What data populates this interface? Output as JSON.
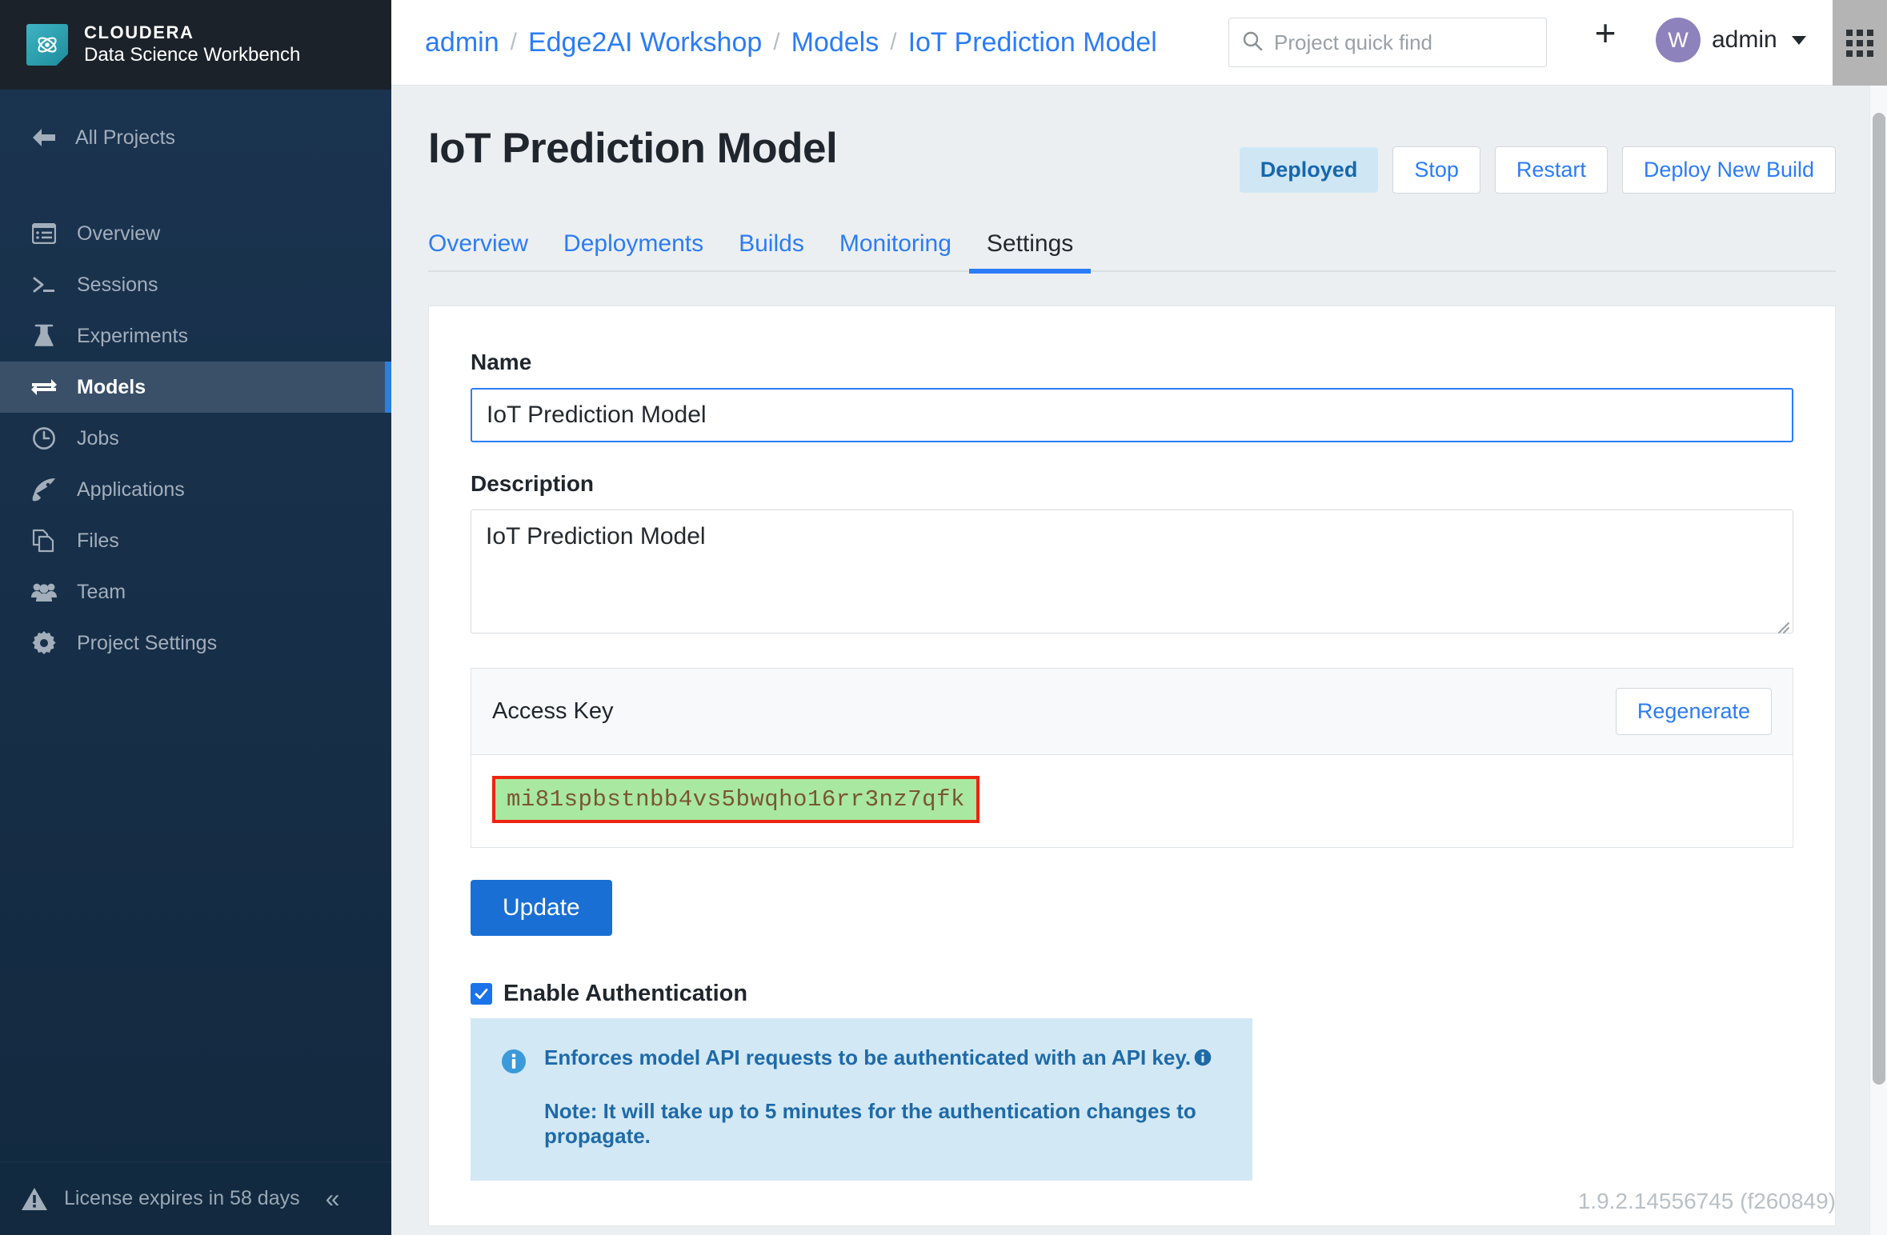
{
  "brand": {
    "logo_icon": "cloudera-atom-icon",
    "name_top": "CLOUDERA",
    "name_sub": "Data Science Workbench"
  },
  "sidebar": {
    "back_label": "All Projects",
    "back_icon": "arrow-left-icon",
    "items": [
      {
        "label": "Overview",
        "icon": "list-panel-icon",
        "active": false
      },
      {
        "label": "Sessions",
        "icon": "terminal-prompt-icon",
        "active": false
      },
      {
        "label": "Experiments",
        "icon": "flask-icon",
        "active": false
      },
      {
        "label": "Models",
        "icon": "exchange-arrows-icon",
        "active": true
      },
      {
        "label": "Jobs",
        "icon": "clock-icon",
        "active": false
      },
      {
        "label": "Applications",
        "icon": "rocket-icon",
        "active": false
      },
      {
        "label": "Files",
        "icon": "files-copy-icon",
        "active": false
      },
      {
        "label": "Team",
        "icon": "people-group-icon",
        "active": false
      },
      {
        "label": "Project Settings",
        "icon": "gear-icon",
        "active": false
      }
    ],
    "license_text": "License expires in 58 days",
    "license_icon": "warning-triangle-icon",
    "collapse_icon": "double-chevron-left-icon"
  },
  "topbar": {
    "breadcrumb": [
      {
        "label": "admin"
      },
      {
        "label": "Edge2AI Workshop"
      },
      {
        "label": "Models"
      },
      {
        "label": "IoT Prediction Model"
      }
    ],
    "separator": "/",
    "search": {
      "placeholder": "Project quick find",
      "value": "",
      "icon": "search-icon"
    },
    "add_icon": "plus-icon",
    "user": {
      "avatar_letter": "W",
      "name": "admin",
      "caret_icon": "chevron-down-icon"
    },
    "apps_grid_icon": "grid-apps-icon"
  },
  "page": {
    "title": "IoT Prediction Model",
    "status_badge": "Deployed",
    "actions": [
      {
        "label": "Stop"
      },
      {
        "label": "Restart"
      },
      {
        "label": "Deploy New Build"
      }
    ],
    "tabs": [
      {
        "label": "Overview",
        "active": false
      },
      {
        "label": "Deployments",
        "active": false
      },
      {
        "label": "Builds",
        "active": false
      },
      {
        "label": "Monitoring",
        "active": false
      },
      {
        "label": "Settings",
        "active": true
      }
    ]
  },
  "form": {
    "name_label": "Name",
    "name_value": "IoT Prediction Model",
    "name_placeholder": "",
    "description_label": "Description",
    "description_value": "IoT Prediction Model",
    "description_placeholder": "",
    "access_key_label": "Access Key",
    "regenerate_label": "Regenerate",
    "access_key_value": "mi81spbstnbb4vs5bwqho16rr3nz7qfk",
    "update_label": "Update",
    "enable_auth_label": "Enable Authentication",
    "enable_auth_checked": true,
    "info_line1": "Enforces model API requests to be authenticated with an API key.",
    "info_line2": "Note: It will take up to 5 minutes for the authentication changes to propagate.",
    "info_icon": "info-circle-icon",
    "info_help_icon": "info-circle-small-icon"
  },
  "footer": {
    "version": "1.9.2.14556745 (f260849)"
  },
  "colors": {
    "link_blue": "#2b7cf7",
    "primary_blue": "#1a6fd4",
    "sidebar_bg": "#18304b",
    "sidebar_active": "#3a5069",
    "badge_bg": "#cfe6f5",
    "badge_text": "#1667ad",
    "key_highlight": "#a8e8a0",
    "key_border": "#ee2411",
    "info_bg": "#d3e8f5",
    "brand_teal": "#3fb4c4",
    "avatar_purple": "#8e82bc"
  }
}
